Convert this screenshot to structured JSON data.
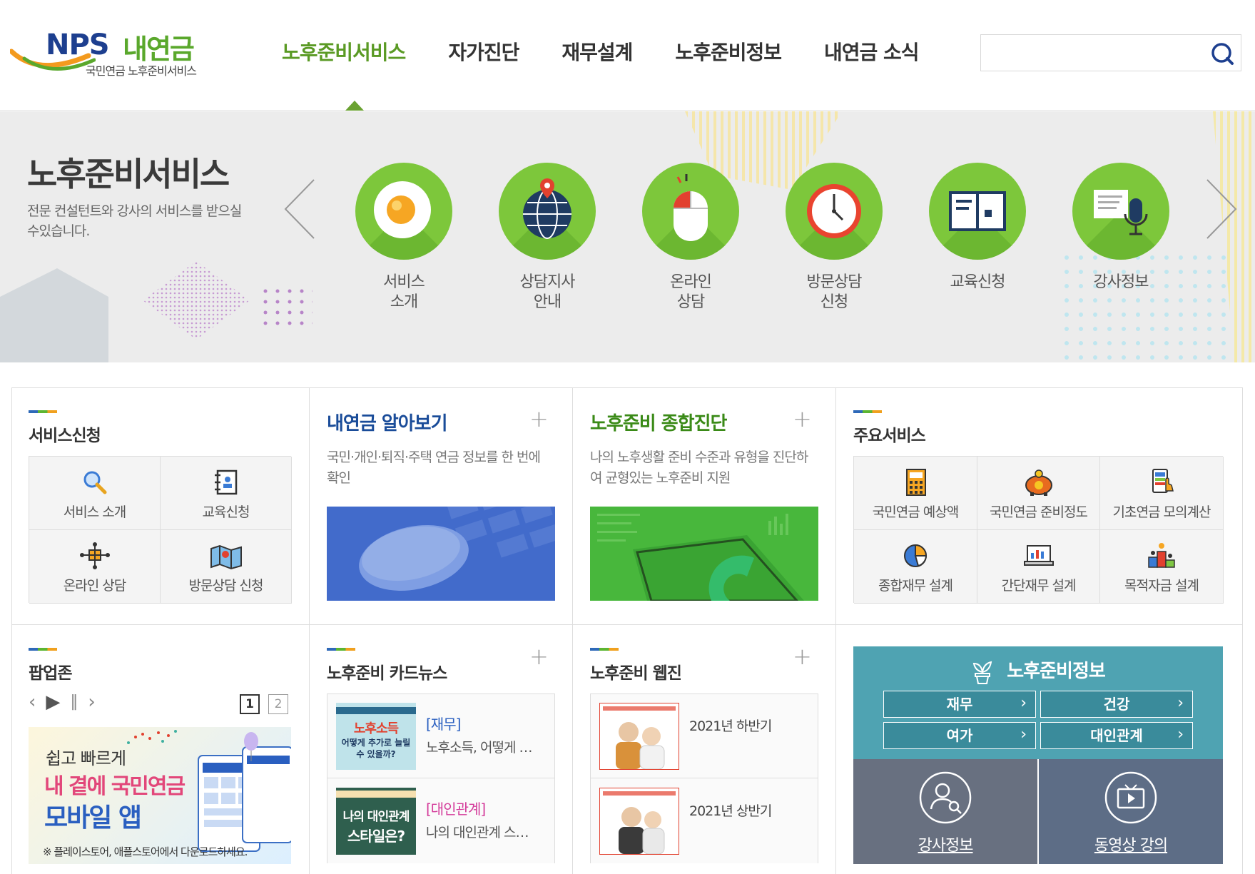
{
  "logo": {
    "nps": "NPS",
    "brand": "내연금",
    "sub": "국민연금 노후준비서비스"
  },
  "gnb": [
    {
      "label": "노후준비서비스"
    },
    {
      "label": "자가진단"
    },
    {
      "label": "재무설계"
    },
    {
      "label": "노후준비정보"
    },
    {
      "label": "내연금 소식"
    }
  ],
  "search": {
    "placeholder": "",
    "icon": "search-icon"
  },
  "hero": {
    "title": "노후준비서비스",
    "desc": "전문 컨설턴트와 강사의 서비스를 받으실 수있습니다.",
    "services": [
      {
        "label": "서비스\n소개",
        "icon": "egg-icon"
      },
      {
        "label": "상담지사\n안내",
        "icon": "globe-pin-icon"
      },
      {
        "label": "온라인\n상담",
        "icon": "mouse-icon"
      },
      {
        "label": "방문상담\n신청",
        "icon": "clock-icon"
      },
      {
        "label": "교육신청",
        "icon": "book-icon"
      },
      {
        "label": "강사정보",
        "icon": "microphone-icon"
      }
    ],
    "accent": "#7dc73b"
  },
  "service_apply": {
    "title": "서비스신청",
    "items": [
      {
        "label": "서비스 소개",
        "icon": "magnifier-icon"
      },
      {
        "label": "교육신청",
        "icon": "notebook-icon"
      },
      {
        "label": "온라인 상담",
        "icon": "network-icon"
      },
      {
        "label": "방문상담 신청",
        "icon": "map-icon"
      }
    ]
  },
  "my_pension": {
    "title": "내연금 알아보기",
    "desc": "국민·개인·퇴직·주택 연금 정보를 한 번에 확인"
  },
  "diagnosis": {
    "title": "노후준비 종합진단",
    "desc": "나의 노후생활 준비 수준과 유형을 진단하여 균형있는 노후준비 지원"
  },
  "main_services": {
    "title": "주요서비스",
    "items": [
      {
        "label": "국민연금 예상액",
        "icon": "calculator-icon"
      },
      {
        "label": "국민연금 준비정도",
        "icon": "piggy-bank-icon"
      },
      {
        "label": "기초연금 모의계산",
        "icon": "phone-touch-icon"
      },
      {
        "label": "종합재무 설계",
        "icon": "pie-chart-icon"
      },
      {
        "label": "간단재무 설계",
        "icon": "laptop-chart-icon"
      },
      {
        "label": "목적자금 설계",
        "icon": "podium-icon"
      }
    ]
  },
  "popup_zone": {
    "title": "팝업존",
    "pages": [
      "1",
      "2"
    ],
    "banner": {
      "line1": "쉽고 빠르게",
      "line2": "내 곁에 국민연금",
      "line3": "모바일 앱",
      "note": "※ 플레이스토어, 애플스토어에서 다운로드하세요."
    }
  },
  "card_news": {
    "title": "노후준비 카드뉴스",
    "items": [
      {
        "tag": "[재무]",
        "text": "노후소득, 어떻게 추가로 늘릴 수 있을까?",
        "thumb_title": "노후소득",
        "thumb_sub": "어떻게 추가로 늘릴 수 있을까?",
        "tag_color": "#2a5fc0"
      },
      {
        "tag": "[대인관계]",
        "text": "나의 대인관계 스타일은?",
        "thumb_title": "나의 대인관계",
        "thumb_sub": "스타일은?",
        "tag_color": "#d43c9b"
      }
    ]
  },
  "webzine": {
    "title": "노후준비 웹진",
    "items": [
      {
        "date": "2021년 하반기"
      },
      {
        "date": "2021년 상반기"
      }
    ]
  },
  "retire_info": {
    "title": "노후준비정보",
    "buttons": [
      "재무",
      "건강",
      "여가",
      "대인관계"
    ],
    "links": [
      {
        "label": "강사정보",
        "icon": "user-search-icon"
      },
      {
        "label": "동영상 강의",
        "icon": "video-icon"
      }
    ]
  }
}
